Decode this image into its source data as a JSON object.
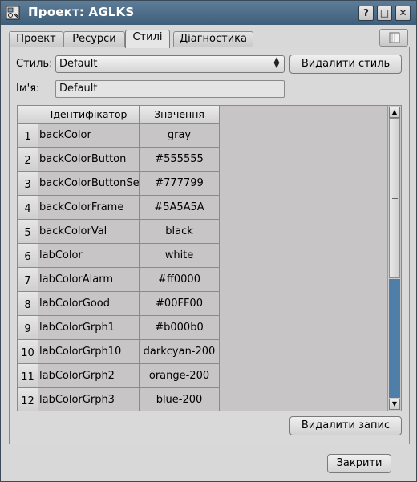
{
  "window": {
    "title": "Проект: AGLKS",
    "controls": {
      "help": "?",
      "minimize": "□",
      "close": "✕"
    }
  },
  "tabs": [
    {
      "label": "Проект"
    },
    {
      "label": "Ресурси"
    },
    {
      "label": "Стилі",
      "active": true
    },
    {
      "label": "Діагностика"
    }
  ],
  "style_form": {
    "style_label": "Стиль:",
    "style_value": "Default",
    "delete_style_label": "Видалити стиль",
    "name_label": "Ім'я:",
    "name_value": "Default"
  },
  "table": {
    "columns": [
      "Ідентифікатор",
      "Значення"
    ],
    "rows": [
      {
        "num": "1",
        "id": "backColor",
        "value": "gray"
      },
      {
        "num": "2",
        "id": "backColorButton",
        "value": "#555555"
      },
      {
        "num": "3",
        "id": "backColorButtonSel",
        "value": "#777799"
      },
      {
        "num": "4",
        "id": "backColorFrame",
        "value": "#5A5A5A"
      },
      {
        "num": "5",
        "id": "backColorVal",
        "value": "black"
      },
      {
        "num": "6",
        "id": "labColor",
        "value": "white"
      },
      {
        "num": "7",
        "id": "labColorAlarm",
        "value": "#ff0000"
      },
      {
        "num": "8",
        "id": "labColorGood",
        "value": "#00FF00"
      },
      {
        "num": "9",
        "id": "labColorGrph1",
        "value": "#b000b0"
      },
      {
        "num": "10",
        "id": "labColorGrph10",
        "value": "darkcyan-200"
      },
      {
        "num": "11",
        "id": "labColorGrph2",
        "value": "orange-200"
      },
      {
        "num": "12",
        "id": "labColorGrph3",
        "value": "blue-200"
      }
    ]
  },
  "delete_record_label": "Видалити запис",
  "close_label": "Закрити",
  "colors": {
    "titlebar": "#4f6e8a",
    "scroll_fill": "#4f7fa8",
    "table_bg": "#c7c5c5"
  }
}
